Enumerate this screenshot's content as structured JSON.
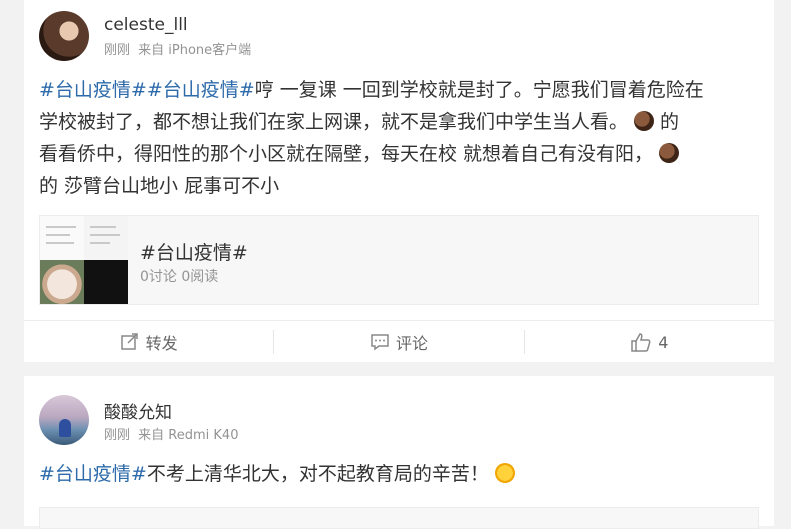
{
  "posts": [
    {
      "username": "celeste_lll",
      "time": "刚刚",
      "source": "来自 iPhone客户端",
      "avatar_icon": "avatar-photo",
      "text_segments": {
        "tag1": "#台山疫情#",
        "tag2": "#台山疫情#",
        "line1": "哼 一复课 一回到学校就是封了。宁愿我们冒着危险在",
        "line2": "学校被封了，都不想让我们在家上网课，就不是拿我们中学生当人看。",
        "after_emoji1": "的",
        "line3": "看看侨中，得阳性的那个小区就在隔壁，每天在校 就想着自己有没有阳，",
        "line4": "的 莎臂台山地小 屁事可不小"
      },
      "topic_card": {
        "title": "#台山疫情#",
        "stats": "0讨论 0阅读"
      },
      "actions": {
        "repost_label": "转发",
        "comment_label": "评论",
        "like_count": "4"
      }
    },
    {
      "username": "酸酸允知",
      "time": "刚刚",
      "source": "来自 Redmi K40",
      "text_segments": {
        "tag1": "#台山疫情#",
        "body": "不考上清华北大，对不起教育局的辛苦！"
      }
    }
  ],
  "colors": {
    "page_bg": "#f2f2f2",
    "card_bg": "#ffffff",
    "tag_blue": "#2e6bab",
    "meta_gray": "#939393"
  },
  "icons": {
    "repost": "repost-icon",
    "comment": "comment-icon",
    "like": "thumbs-up-icon"
  }
}
